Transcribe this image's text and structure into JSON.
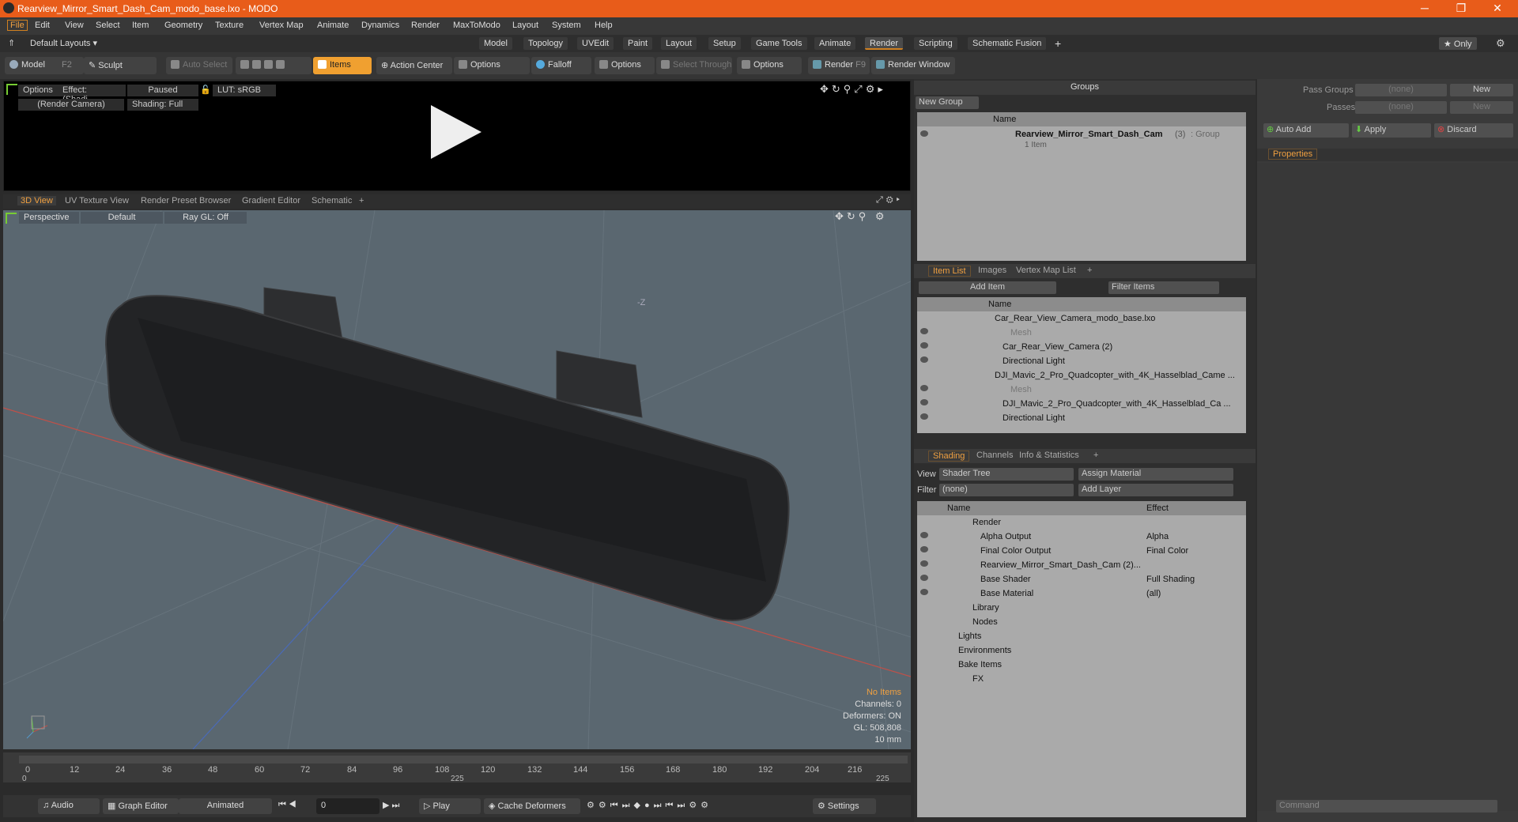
{
  "window": {
    "title": "Rearview_Mirror_Smart_Dash_Cam_modo_base.lxo - MODO",
    "controls": [
      "─",
      "❐",
      "✕"
    ]
  },
  "menu": [
    "File",
    "Edit",
    "View",
    "Select",
    "Item",
    "Geometry",
    "Texture",
    "Vertex Map",
    "Animate",
    "Dynamics",
    "Render",
    "MaxToModo",
    "Layout",
    "System",
    "Help"
  ],
  "layouts": {
    "label": "Default Layouts ▾"
  },
  "modes": [
    "Model",
    "Topology",
    "UVEdit",
    "Paint",
    "Layout",
    "Setup",
    "Game Tools",
    "Animate",
    "Render",
    "Scripting",
    "Schematic Fusion",
    "+"
  ],
  "only_label": "★ Only",
  "toolbar": {
    "model": "Model",
    "model_key": "F2",
    "sculpt": "Sculpt",
    "auto_select": "Auto Select",
    "items": "Items",
    "action_center": "Action Center",
    "options1": "Options",
    "falloff": "Falloff",
    "options2": "Options",
    "select_through": "Select Through",
    "options3": "Options",
    "render": "Render",
    "render_key": "F9",
    "render_window": "Render Window"
  },
  "preview": {
    "options": "Options",
    "effect": "Effect: (Shadi...",
    "paused": "Paused",
    "lut": "LUT: sRGB",
    "camera": "(Render Camera)",
    "shading": "Shading: Full"
  },
  "view_tabs": [
    "3D View",
    "UV Texture View",
    "Render Preset Browser",
    "Gradient Editor",
    "Schematic",
    "+"
  ],
  "viewport": {
    "perspective": "Perspective",
    "default": "Default",
    "raygl": "Ray GL: Off",
    "axis_label": "-Z"
  },
  "viewport_info": {
    "items": "No Items",
    "channels": "Channels: 0",
    "deformers": "Deformers: ON",
    "gl": "GL: 508,808",
    "scale": "10 mm"
  },
  "timeline": {
    "ticks": [
      "0",
      "12",
      "24",
      "36",
      "48",
      "60",
      "72",
      "84",
      "96",
      "108",
      "120",
      "132",
      "144",
      "156",
      "168",
      "180",
      "192",
      "204",
      "216"
    ],
    "start": "0",
    "mid": "225",
    "end": "225"
  },
  "transport": {
    "audio": "Audio",
    "graph": "Graph Editor",
    "animated": "Animated",
    "frame": "0",
    "play": "Play",
    "cache": "Cache Deformers",
    "settings": "Settings"
  },
  "groups": {
    "title": "Groups",
    "new_group": "New Group",
    "col_name": "Name",
    "item": "Rearview_Mirror_Smart_Dash_Cam",
    "item_count": "(3)",
    "item_type": ": Group",
    "item_sub": "1 Item"
  },
  "itemlist": {
    "tabs": [
      "Item List",
      "Images",
      "Vertex Map List",
      "+"
    ],
    "add_item": "Add Item",
    "filter": "Filter Items",
    "col": "Name",
    "rows": [
      "Car_Rear_View_Camera_modo_base.lxo",
      "Mesh",
      "Car_Rear_View_Camera (2)",
      "Directional Light",
      "DJI_Mavic_2_Pro_Quadcopter_with_4K_Hasselblad_Came ...",
      "Mesh",
      "DJI_Mavic_2_Pro_Quadcopter_with_4K_Hasselblad_Ca ...",
      "Directional Light"
    ]
  },
  "shading": {
    "tabs": [
      "Shading",
      "Channels",
      "Info & Statistics",
      "+"
    ],
    "view_label": "View",
    "view_val": "Shader Tree",
    "assign": "Assign Material",
    "filter_label": "Filter",
    "filter_val": "(none)",
    "add_layer": "Add Layer",
    "col_name": "Name",
    "col_effect": "Effect",
    "rows": [
      [
        "Render",
        ""
      ],
      [
        "Alpha Output",
        "Alpha"
      ],
      [
        "Final Color Output",
        "Final Color"
      ],
      [
        "Rearview_Mirror_Smart_Dash_Cam (2)...",
        ""
      ],
      [
        "Base Shader",
        "Full Shading"
      ],
      [
        "Base Material",
        "(all)"
      ],
      [
        "Library",
        ""
      ],
      [
        "Nodes",
        ""
      ],
      [
        "Lights",
        ""
      ],
      [
        "Environments",
        ""
      ],
      [
        "Bake Items",
        ""
      ],
      [
        "FX",
        ""
      ]
    ]
  },
  "far": {
    "pass_groups": "Pass Groups",
    "passes": "Passes",
    "none": "(none)",
    "new": "New",
    "auto_add": "Auto Add",
    "apply": "Apply",
    "discard": "Discard",
    "properties": "Properties",
    "command": "Command"
  }
}
